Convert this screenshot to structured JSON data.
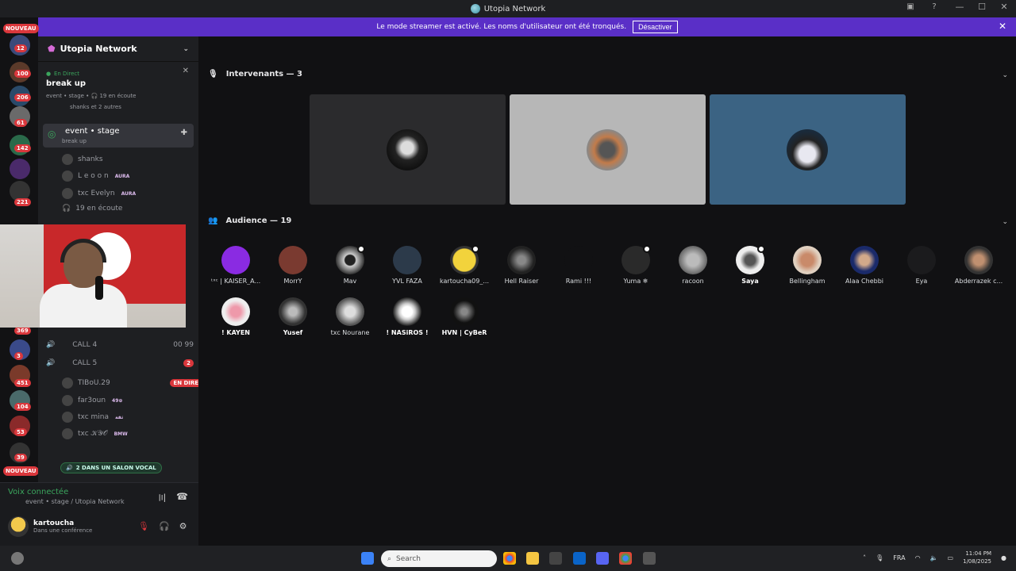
{
  "window": {
    "title": "Utopia Network"
  },
  "banner": {
    "text": "Le mode streamer est activé. Les noms d'utilisateur ont été tronqués.",
    "button": "Désactiver"
  },
  "server_badges": [
    "NOUVEAU",
    "12",
    "100",
    "206",
    "61",
    "142",
    "221",
    "369",
    "3",
    "451",
    "104",
    "53",
    "39",
    "NOUVEAU"
  ],
  "sidebar": {
    "server_name": "Utopia Network",
    "live_label": "En Direct",
    "event_title": "break up",
    "event_meta": "event • stage • 🎧 19 en écoute",
    "event_attendees": "shanks et 2 autres",
    "stage_channel": "event • stage",
    "stage_sub": "break up",
    "speakers": [
      {
        "name": "shanks",
        "tag": ""
      },
      {
        "name": "L e o o n",
        "tag": "AURA"
      },
      {
        "name": "txc Evelyn",
        "tag": "AURA"
      }
    ],
    "listening": "19 en écoute",
    "calls": [
      {
        "label": "CALL 4",
        "count": "00 99"
      },
      {
        "label": "CALL 5",
        "count": "2"
      }
    ],
    "call5_members": [
      {
        "name": "TIBoU.29",
        "tag": "EN DIRECT"
      },
      {
        "name": "far3oun",
        "tag": "49⊕"
      },
      {
        "name": "txc mina",
        "tag": "ثقة"
      },
      {
        "name": "txc 𝒦𝒴𝒪",
        "tag": "BMW"
      }
    ],
    "voice_pill": "2 DANS UN SALON VOCAL",
    "voice_connected": "Voix connectée",
    "voice_channel": "event • stage / Utopia Network",
    "user": {
      "name": "kartoucha",
      "status": "Dans une conférence"
    }
  },
  "stage": {
    "speakers_header": "Intervenants — 3",
    "audience_header": "Audience — 19",
    "audience": [
      {
        "name": "ᵗˣᶜ | KAISER_A...",
        "bold": false
      },
      {
        "name": "MorrY",
        "bold": false
      },
      {
        "name": "Mav",
        "bold": false
      },
      {
        "name": "YVL FAZA",
        "bold": false
      },
      {
        "name": "kartoucha09_...",
        "bold": false
      },
      {
        "name": "Hell Raiser",
        "bold": false
      },
      {
        "name": "Rami !!!",
        "bold": false
      },
      {
        "name": "Yuma ❄",
        "bold": false
      },
      {
        "name": "racoon",
        "bold": false
      },
      {
        "name": "Saya",
        "bold": true
      },
      {
        "name": "Bellingham",
        "bold": false
      },
      {
        "name": "Alaa Chebbi",
        "bold": false
      },
      {
        "name": "Eya",
        "bold": false
      },
      {
        "name": "Abderrazek c...",
        "bold": false
      },
      {
        "name": "! KAYEN",
        "bold": true
      },
      {
        "name": "Yusef",
        "bold": true
      },
      {
        "name": "txc Nourane",
        "bold": false
      },
      {
        "name": "! NASiROS !",
        "bold": true
      },
      {
        "name": "HVN | CyBeR",
        "bold": true
      }
    ]
  },
  "taskbar": {
    "search": "Search",
    "lang": "FRA",
    "time": "11:04 PM",
    "date": "1/08/2025"
  }
}
